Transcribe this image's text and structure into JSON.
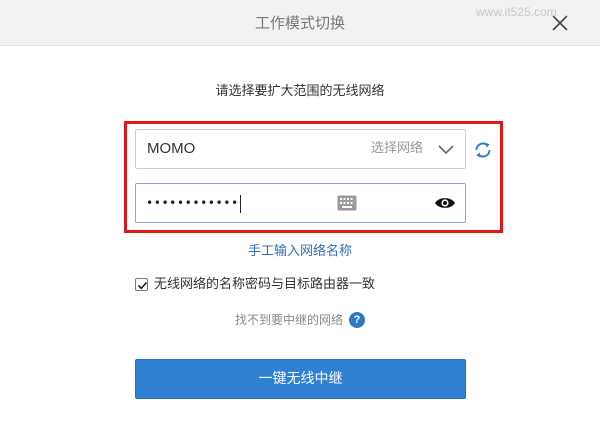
{
  "dialog": {
    "title": "工作模式切换",
    "watermark": "www.it525.com"
  },
  "subtitle": "请选择要扩大范围的无线网络",
  "network": {
    "ssid_value": "MOMO",
    "select_label": "选择网络"
  },
  "password": {
    "masked_value": "••••••••••••"
  },
  "manual_link": "手工输入网络名称",
  "sync_option": {
    "label": "无线网络的名称密码与目标路由器一致",
    "checked": true
  },
  "help": {
    "text": "找不到要中继的网络",
    "icon_glyph": "?"
  },
  "primary_button": "一键无线中继",
  "colors": {
    "accent": "#2f7fd3",
    "link": "#2f6eb3",
    "highlight": "#e01818"
  },
  "icons": [
    "close-icon",
    "chevron-down-icon",
    "refresh-icon",
    "keyboard-icon",
    "eye-icon",
    "help-icon",
    "checkmark-icon"
  ]
}
